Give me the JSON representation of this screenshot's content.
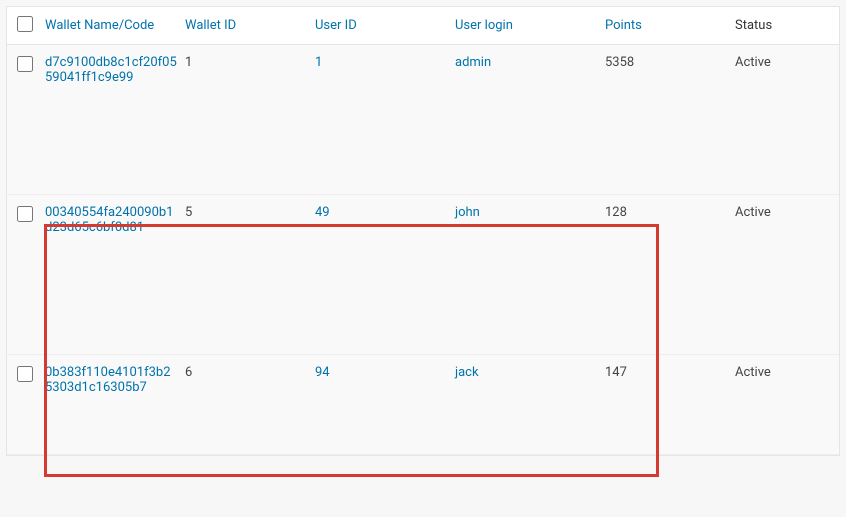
{
  "table": {
    "headers": {
      "name": "Wallet Name/Code",
      "wallet_id": "Wallet ID",
      "user_id": "User ID",
      "user_login": "User login",
      "points": "Points",
      "status": "Status"
    },
    "rows": [
      {
        "name": "d7c9100db8c1cf20f0559041ff1c9e99",
        "wallet_id": "1",
        "user_id": "1",
        "user_login": "admin",
        "points": "5358",
        "status": "Active"
      },
      {
        "name": "00340554fa240090b1d23d65c6bf0d81",
        "wallet_id": "5",
        "user_id": "49",
        "user_login": "john",
        "points": "128",
        "status": "Active"
      },
      {
        "name": "0b383f110e4101f3b25303d1c16305b7",
        "wallet_id": "6",
        "user_id": "94",
        "user_login": "jack",
        "points": "147",
        "status": "Active"
      }
    ]
  }
}
